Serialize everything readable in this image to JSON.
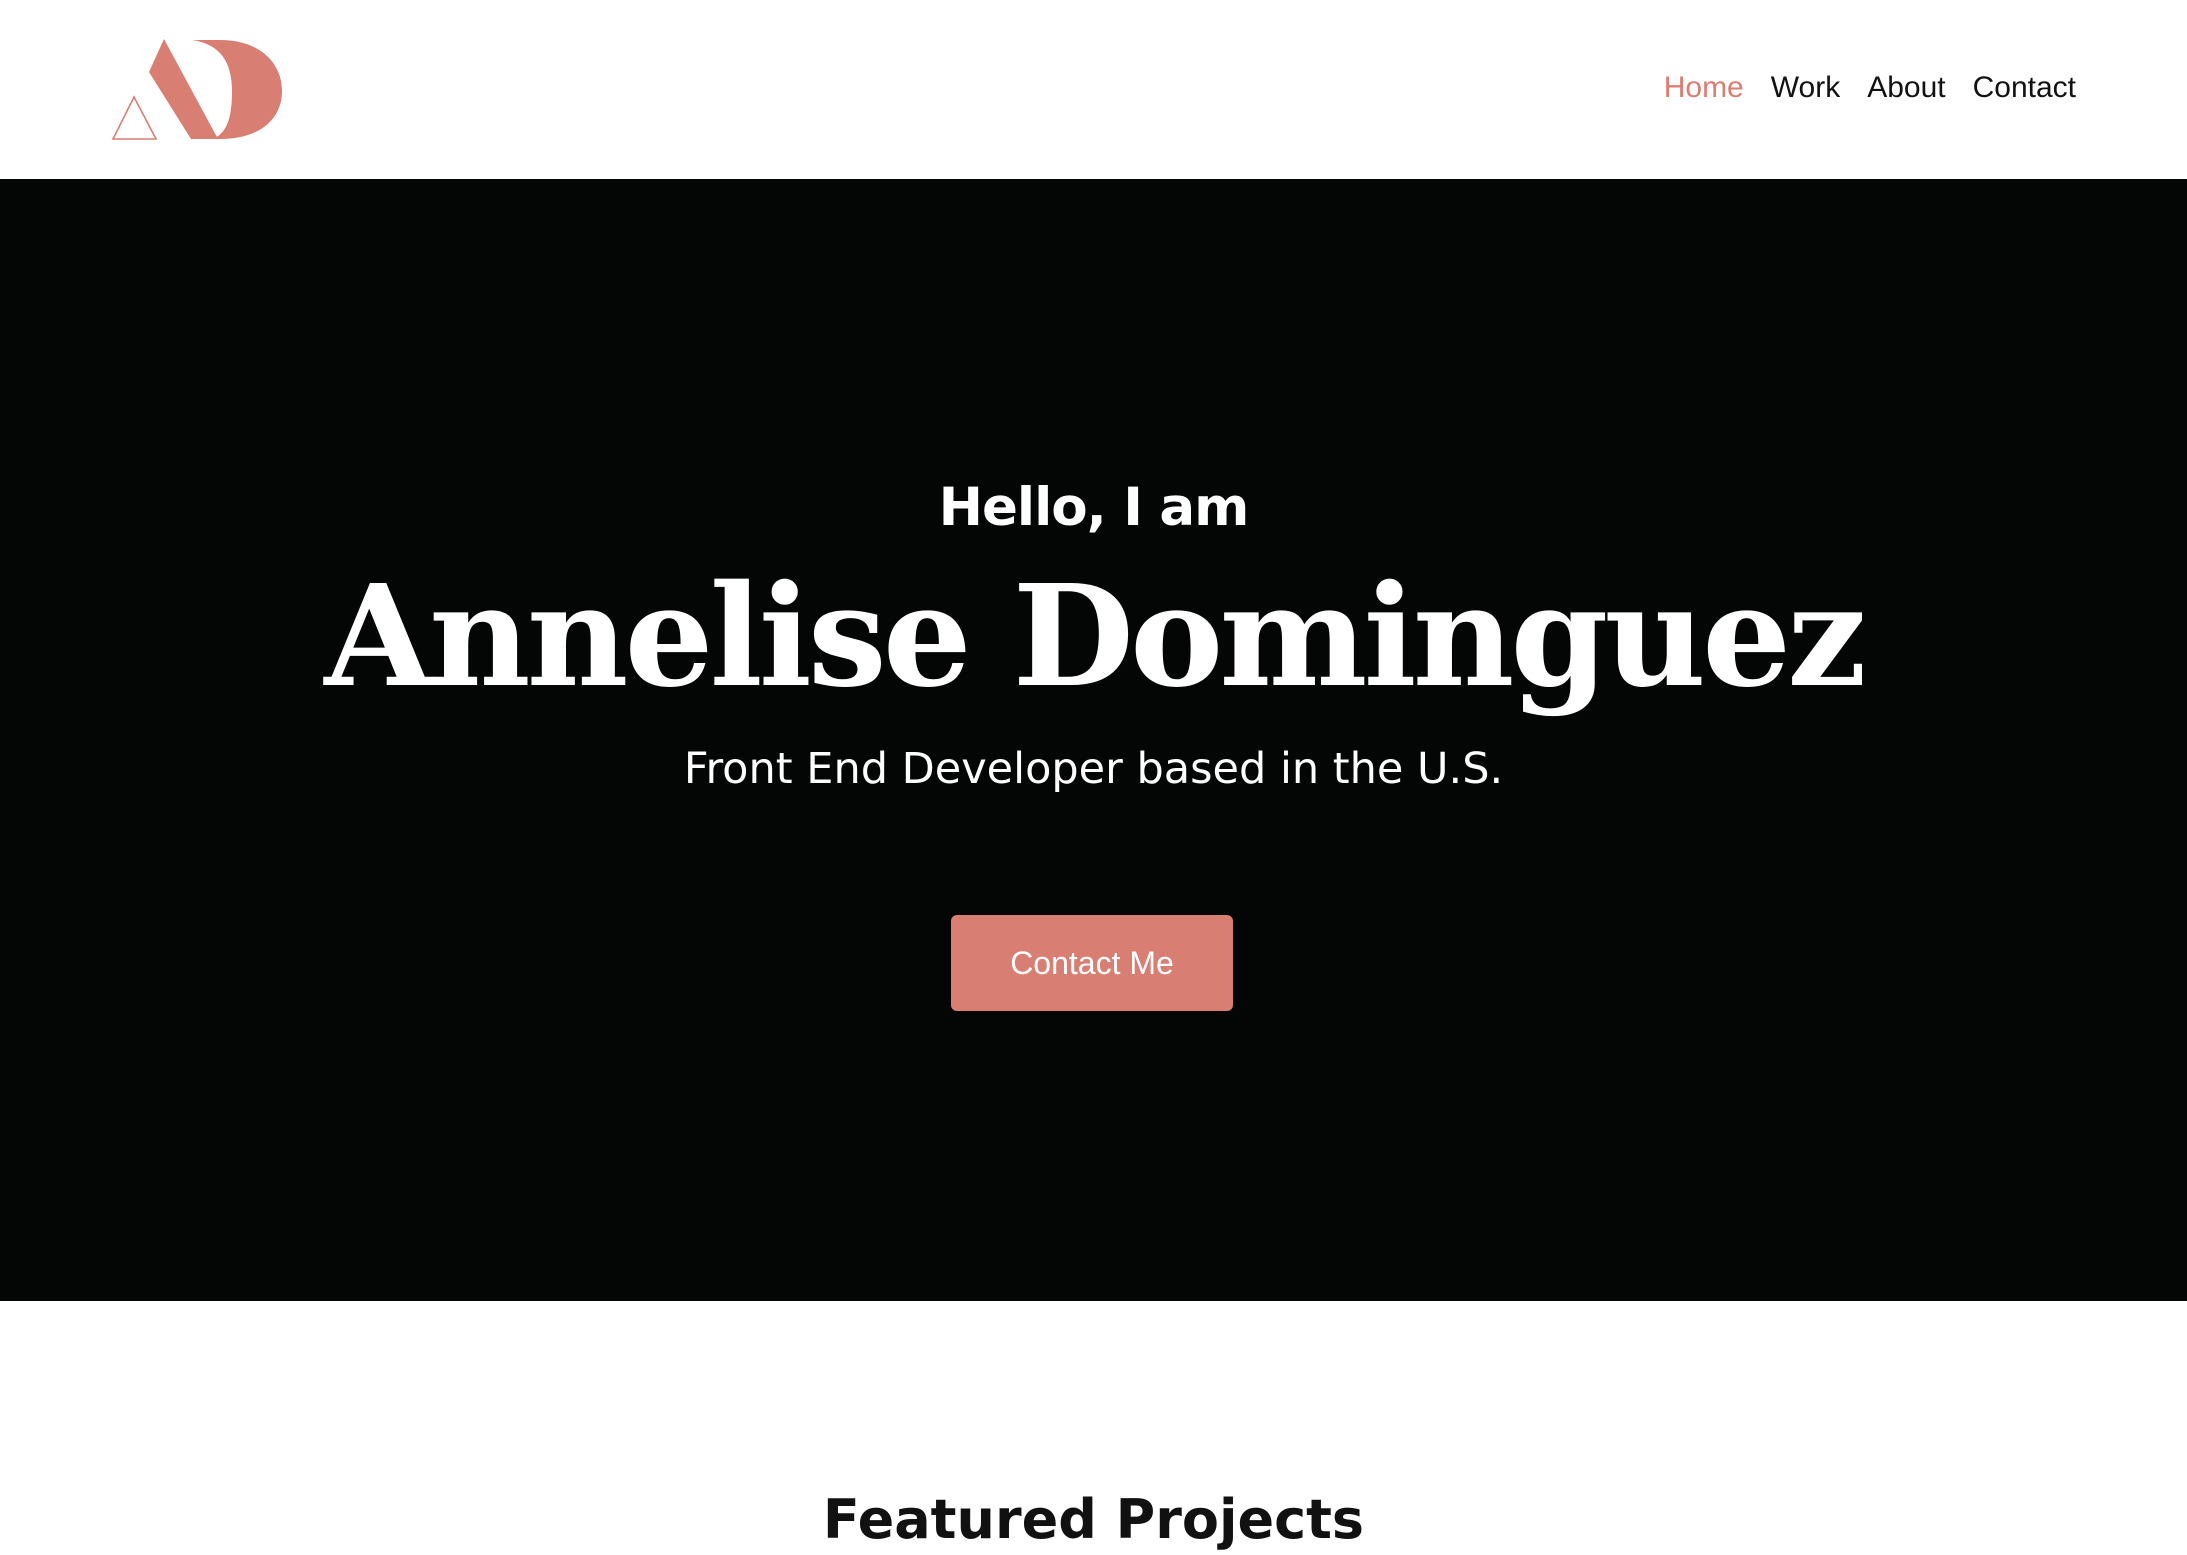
{
  "colors": {
    "accent": "#d97e72",
    "hero_background": "#030605",
    "text_dark": "#111111",
    "text_light": "#ffffff"
  },
  "logo": {
    "icon": "ad-monogram-logo"
  },
  "nav": {
    "items": [
      {
        "label": "Home",
        "active": true
      },
      {
        "label": "Work",
        "active": false
      },
      {
        "label": "About",
        "active": false
      },
      {
        "label": "Contact",
        "active": false
      }
    ]
  },
  "hero": {
    "greeting": "Hello, I am",
    "name": "Annelise Dominguez",
    "tagline": "Front End Developer based in the U.S.",
    "cta_label": "Contact Me"
  },
  "featured": {
    "title": "Featured Projects"
  }
}
